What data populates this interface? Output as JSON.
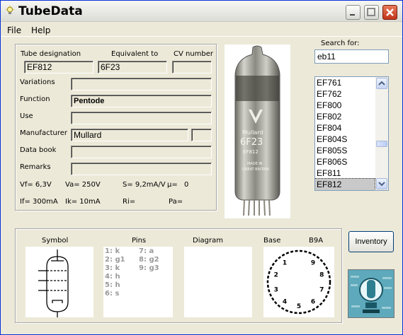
{
  "window": {
    "title": "TubeData"
  },
  "menu": {
    "file": "File",
    "help": "Help"
  },
  "labels": {
    "tube_designation": "Tube designation",
    "equivalent_to": "Equivalent to",
    "cv_number": "CV number",
    "variations": "Variations",
    "function": "Function",
    "use": "Use",
    "manufacturer": "Manufacturer",
    "data_book": "Data book",
    "remarks": "Remarks"
  },
  "tube": {
    "designation": "EF812",
    "equivalent": "6F23",
    "cv_number": "",
    "variations": "",
    "function": "Pentode",
    "use": "",
    "manufacturer": "Mullard",
    "manufacturer_extra": "",
    "data_book": "",
    "remarks": ""
  },
  "params": {
    "vf": "Vf= 6,3V",
    "va": "Va= 250V",
    "s": "S= 9,2mA/V",
    "mu": "µ=",
    "mu_val": "0",
    "if": "If= 300mA",
    "ik": "Ik=  10mA",
    "ri": "Ri=",
    "pa": "Pa="
  },
  "photo_text": {
    "brand": "Mullard",
    "type": "6F23",
    "sub": "EF812",
    "made": "MADE IN",
    "country": "GREAT BRITAIN"
  },
  "search": {
    "label": "Search for:",
    "value": "eb11"
  },
  "tube_list": [
    "EF761",
    "EF762",
    "EF800",
    "EF802",
    "EF804",
    "EF804S",
    "EF805S",
    "EF806S",
    "EF811",
    "EF812"
  ],
  "selected_tube": "EF812",
  "bottom": {
    "symbol": "Symbol",
    "pins": "Pins",
    "diagram": "Diagram",
    "base": "Base",
    "base_type": "B9A"
  },
  "pins_left": [
    "1: k",
    "2: g1",
    "3: k",
    "4: h",
    "5: h",
    "6: s"
  ],
  "pins_right": [
    "7: a",
    "8: g2",
    "9: g3"
  ],
  "base_pins": [
    "1",
    "2",
    "3",
    "4",
    "5",
    "6",
    "7",
    "8",
    "9"
  ],
  "inventory_button": "Inventory"
}
